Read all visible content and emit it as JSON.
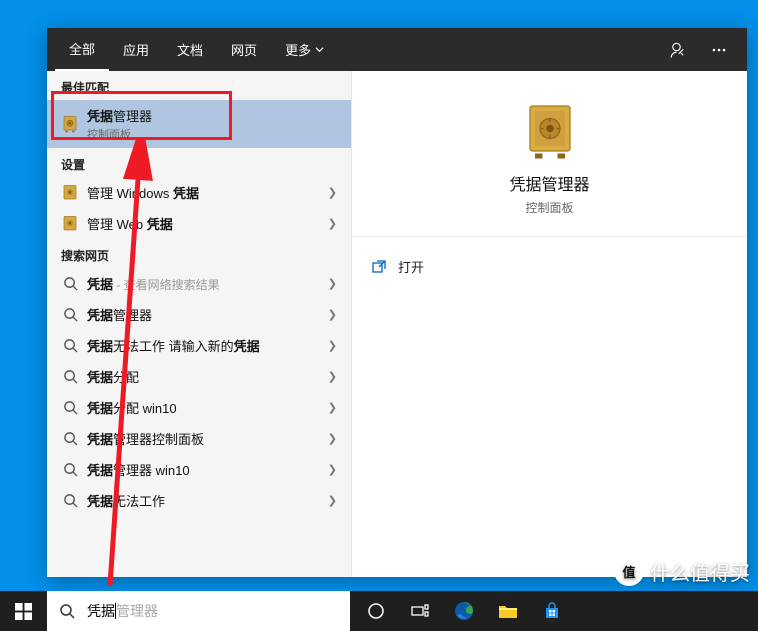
{
  "tabs": {
    "all": "全部",
    "apps": "应用",
    "docs": "文档",
    "web": "网页",
    "more": "更多"
  },
  "sections": {
    "best_match": "最佳匹配",
    "settings": "设置",
    "web": "搜索网页"
  },
  "best_match": {
    "title": "凭据",
    "title_suffix": "管理器",
    "subtitle": "控制面板"
  },
  "settings_items": [
    {
      "prefix": "管理 Wind",
      "mid": "ows ",
      "bold": "凭据"
    },
    {
      "prefix": "管理 We",
      "mid": "b ",
      "bold": "凭据"
    }
  ],
  "web_items": [
    {
      "text": "凭据",
      "hint": " - 查看网络搜索结果"
    },
    {
      "text": "凭据管理器",
      "hint": ""
    },
    {
      "text": "凭据无法工作 请输入新的凭据",
      "hint": ""
    },
    {
      "text": "凭据分配",
      "hint": ""
    },
    {
      "text": "凭据分配 win10",
      "hint": ""
    },
    {
      "text": "凭据管理器控制面板",
      "hint": ""
    },
    {
      "text": "凭据管理器 win10",
      "hint": ""
    },
    {
      "text": "凭据无法工作",
      "hint": ""
    }
  ],
  "preview": {
    "title": "凭据管理器",
    "subtitle": "控制面板",
    "open": "打开"
  },
  "search": {
    "value": "凭据",
    "placeholder": "管理器"
  },
  "watermark": "什么值得买",
  "watermark_badge": "值"
}
